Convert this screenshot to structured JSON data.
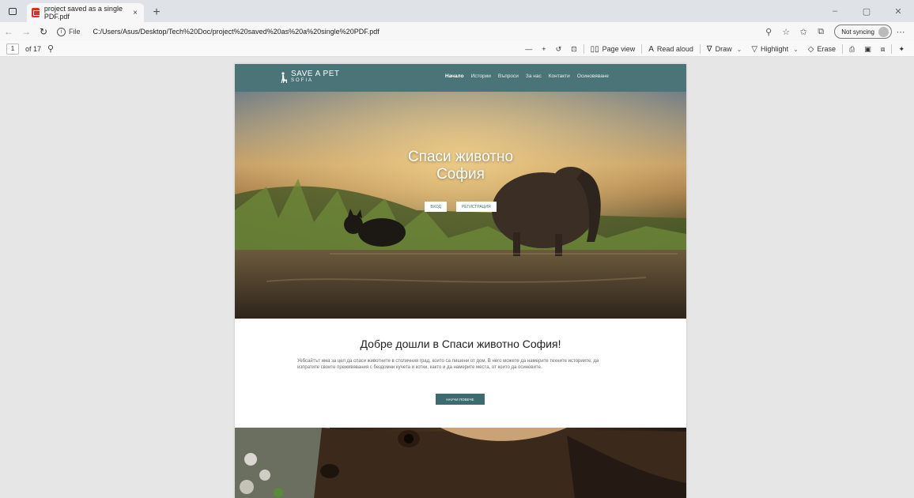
{
  "browser": {
    "tab_title": "project saved as a single PDF.pdf",
    "tab_close": "×",
    "new_tab": "+",
    "window_controls": [
      "–",
      "▢",
      "✕"
    ],
    "address": {
      "file_label": "File",
      "url": "C:/Users/Asus/Desktop/Tech%20Doc/project%20saved%20as%20a%20single%20PDF.pdf",
      "sync_label": "Not syncing"
    }
  },
  "pdf_toolbar": {
    "page_number": "1",
    "of_pages": "of 17",
    "zoom_out": "—",
    "zoom_in": "+",
    "page_view": "Page view",
    "read_aloud": "Read aloud",
    "draw": "Draw",
    "highlight": "Highlight",
    "erase": "Erase"
  },
  "site": {
    "logo": "SAVE A PET",
    "logo_sub": "SOFIA",
    "nav": [
      "Начало",
      "Истории",
      "Въпроси",
      "За нас",
      "Контакти",
      "Осиновяване"
    ],
    "hero_title_line1": "Спаси животно",
    "hero_title_line2": "София",
    "login_button": "ВХОД",
    "register_button": "РЕГИСТРАЦИЯ",
    "welcome_title": "Добре дошли в Спаси животно София!",
    "welcome_text": "Уебсайтът има за цел да спаси животните в столичния град, които са лишени от дом. В него можете да намерите техните историите, да изпратите своите преживявания с бездомни кучета и котки, както и да намерите места, от които да осиновите.",
    "learn_more_button": "НАУЧИ ПОВЕЧЕ"
  }
}
